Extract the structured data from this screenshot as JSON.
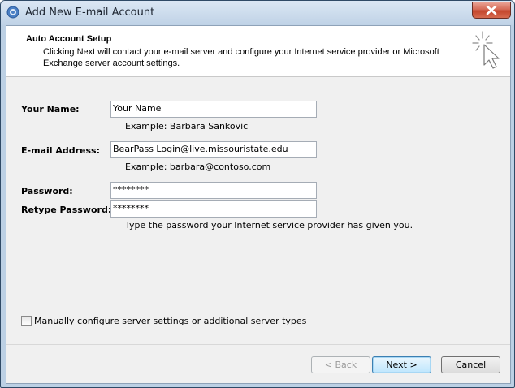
{
  "window": {
    "title": "Add New E-mail Account"
  },
  "header": {
    "title": "Auto Account Setup",
    "description": "Clicking Next will contact your e-mail server and configure your Internet service provider or Microsoft Exchange server account settings."
  },
  "form": {
    "name_label": "Your Name:",
    "name_value": "Your Name",
    "name_hint": "Example: Barbara Sankovic",
    "email_label": "E-mail Address:",
    "email_value": "BearPass Login@live.missouristate.edu",
    "email_hint": "Example: barbara@contoso.com",
    "password_label": "Password:",
    "password_value": "********",
    "retype_label": "Retype Password:",
    "retype_value": "********",
    "password_hint": "Type the password your Internet service provider has given you."
  },
  "options": {
    "manual_config_label": "Manually configure server settings or additional server types",
    "manual_config_checked": false
  },
  "buttons": {
    "back": "< Back",
    "next": "Next >",
    "cancel": "Cancel"
  }
}
